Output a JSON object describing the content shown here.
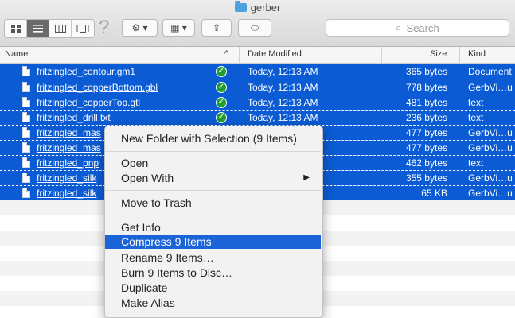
{
  "window": {
    "title": "gerber"
  },
  "toolbar": {
    "view_icons": [
      "icon-view-icon",
      "list-view-icon",
      "column-view-icon",
      "coverflow-view-icon"
    ],
    "help_glyph": "?",
    "action_glyph": "⚙ ▾",
    "arrange_glyph": "▦ ▾",
    "share_glyph": "⇪",
    "tag_glyph": "⬭",
    "search_placeholder": "Search",
    "search_glyph": "⌕"
  },
  "columns": {
    "name": "Name",
    "sort_glyph": "^",
    "date": "Date Modified",
    "size": "Size",
    "kind": "Kind"
  },
  "files": [
    {
      "name": "fritzingled_contour.gm1",
      "date": "Today, 12:13 AM",
      "size": "365 bytes",
      "kind": "Document"
    },
    {
      "name": "fritzingled_copperBottom.gbl",
      "date": "Today, 12:13 AM",
      "size": "778 bytes",
      "kind": "GerbVi…u"
    },
    {
      "name": "fritzingled_copperTop.gtl",
      "date": "Today, 12:13 AM",
      "size": "481 bytes",
      "kind": "text"
    },
    {
      "name": "fritzingled_drill.txt",
      "date": "Today, 12:13 AM",
      "size": "236 bytes",
      "kind": "text"
    },
    {
      "name": "fritzingled_mas",
      "date": "",
      "size": "477 bytes",
      "kind": "GerbVi…u"
    },
    {
      "name": "fritzingled_mas",
      "date": "",
      "size": "477 bytes",
      "kind": "GerbVi…u"
    },
    {
      "name": "fritzingled_pnp",
      "date": "",
      "size": "462 bytes",
      "kind": "text"
    },
    {
      "name": "fritzingled_silk",
      "date": "",
      "size": "355 bytes",
      "kind": "GerbVi…u"
    },
    {
      "name": "fritzingled_silk",
      "date": "",
      "size": "65 KB",
      "kind": "GerbVi…u"
    }
  ],
  "status_glyph": "✓",
  "context_menu": {
    "new_folder": "New Folder with Selection (9 Items)",
    "open": "Open",
    "open_with": "Open With",
    "submenu_arrow": "▶",
    "move_to_trash": "Move to Trash",
    "get_info": "Get Info",
    "compress": "Compress 9 Items",
    "rename": "Rename 9 Items…",
    "burn": "Burn 9 Items to Disc…",
    "duplicate": "Duplicate",
    "make_alias": "Make Alias"
  }
}
